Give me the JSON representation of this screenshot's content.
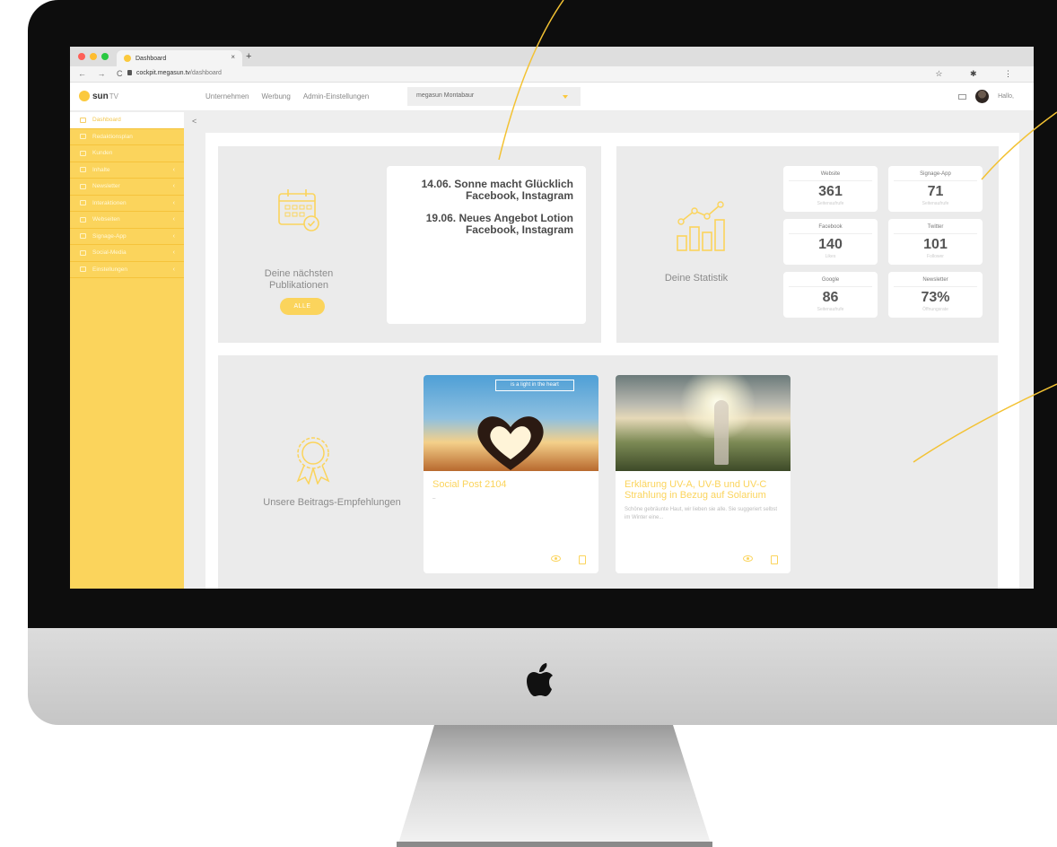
{
  "browser": {
    "tab_title": "Dashboard",
    "tab_close": "×",
    "tab_new": "+",
    "nav": "← → C",
    "url_host": "cockpit.megasun.tv",
    "url_path": "/dashboard",
    "icons": [
      "star-icon",
      "extension-icon",
      "menu-icon"
    ],
    "icon_glyphs": "☆ ✱ ⋮",
    "traffic_light_colors": [
      "#fe5f57",
      "#febc2e",
      "#28c840"
    ]
  },
  "header": {
    "logo_text": "sun",
    "logo_suffix": "TV",
    "nav": [
      "Unternehmen",
      "Werbung",
      "Admin-Einstellungen"
    ],
    "company_select": "megasun Montabaur",
    "greeting": "Hallo,"
  },
  "sidebar": {
    "items": [
      {
        "label": "Dashboard",
        "icon": "home-icon",
        "active": true
      },
      {
        "label": "Redaktionsplan",
        "icon": "grid-icon"
      },
      {
        "label": "Kunden",
        "icon": "user-icon"
      },
      {
        "label": "Inhalte",
        "icon": "layers-icon",
        "has_arrow": true
      },
      {
        "label": "Newsletter",
        "icon": "mail-icon",
        "has_arrow": true
      },
      {
        "label": "Interaktionen",
        "icon": "chat-icon",
        "has_arrow": true
      },
      {
        "label": "Webseiten",
        "icon": "browser-icon",
        "has_arrow": true
      },
      {
        "label": "Signage-App",
        "icon": "monitor-icon",
        "has_arrow": true
      },
      {
        "label": "Social-Media",
        "icon": "share-icon",
        "has_arrow": true
      },
      {
        "label": "Einstellungen",
        "icon": "cog-icon",
        "has_arrow": true
      }
    ],
    "arrow": "‹",
    "collapse": "<"
  },
  "publications": {
    "caption_line1": "Deine nächsten",
    "caption_line2": "Publikationen",
    "all_button": "ALLE",
    "entries": [
      {
        "title": "14.06. Sonne macht Glücklich",
        "channels": "Facebook, Instagram"
      },
      {
        "title": "19.06. Neues Angebot Lotion",
        "channels": "Facebook, Instagram"
      }
    ]
  },
  "statistics": {
    "caption": "Deine Statistik",
    "cards": [
      {
        "label": "Website",
        "value": "361",
        "sub": "Seitenaufrufe"
      },
      {
        "label": "Signage-App",
        "value": "71",
        "sub": "Seitenaufrufe"
      },
      {
        "label": "Facebook",
        "value": "140",
        "sub": "Likes"
      },
      {
        "label": "Twitter",
        "value": "101",
        "sub": "Follower"
      },
      {
        "label": "Google",
        "value": "86",
        "sub": "Seitenaufrufe"
      },
      {
        "label": "Newsletter",
        "value": "73%",
        "sub": "Öffnungsrate"
      }
    ]
  },
  "recommendations": {
    "caption": "Unsere Beitrags-Empfehlungen",
    "posts": [
      {
        "image_banner": "is a light in the heart",
        "title": "Social Post 2104",
        "excerpt": "–"
      },
      {
        "title": "Erklärung UV-A, UV-B und UV-C Strahlung in Bezug auf Solarium",
        "excerpt": "Schöne gebräunte Haut, wir lieben sie alle. Sie suggeriert selbst im Winter eine..."
      }
    ]
  },
  "colors": {
    "accent": "#fbd45c",
    "frame": "#0d0d0d",
    "panel": "#ebebeb",
    "callout": "#f3c233"
  }
}
